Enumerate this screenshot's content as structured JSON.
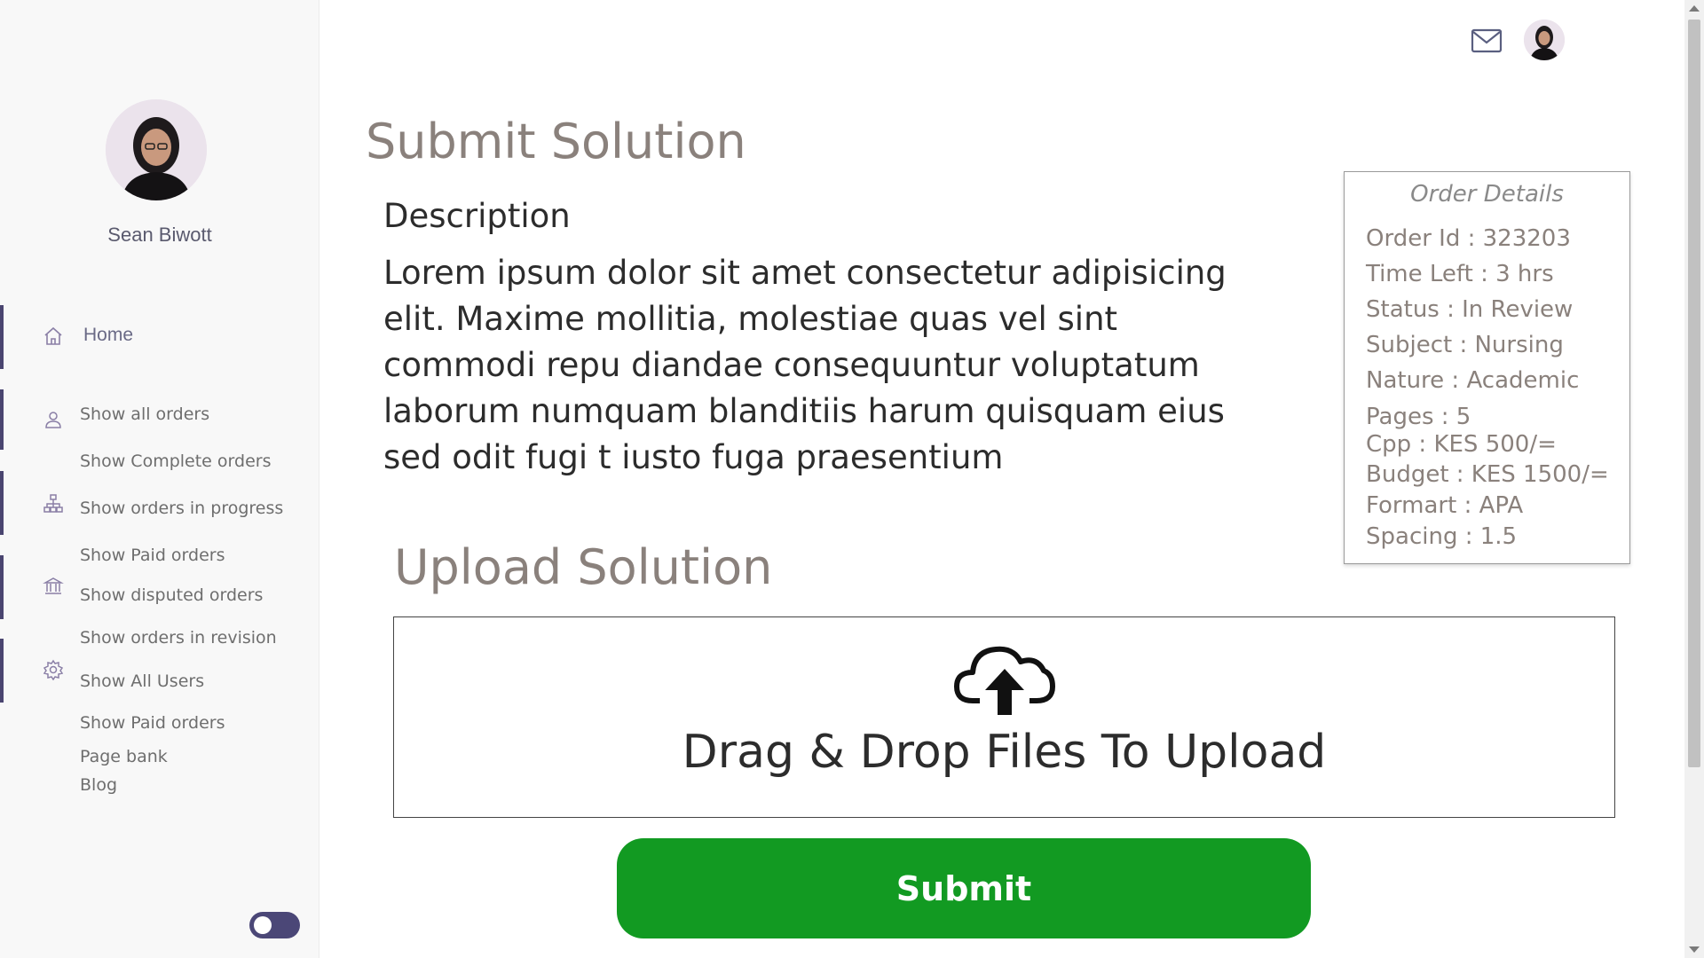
{
  "sidebar": {
    "user_name": "Sean Biwott",
    "home_label": "Home",
    "items": [
      {
        "label": "Show all orders"
      },
      {
        "label": "Show Complete orders"
      },
      {
        "label": "Show orders in progress"
      },
      {
        "label": "Show Paid orders"
      },
      {
        "label": "Show disputed orders"
      },
      {
        "label": "Show orders in revision"
      },
      {
        "label": "Show All Users"
      },
      {
        "label": "Show Paid orders"
      },
      {
        "label": "Page bank"
      },
      {
        "label": "Blog"
      }
    ],
    "icons": [
      "home-icon",
      "user-icon",
      "sitemap-icon",
      "bank-icon",
      "gear-icon"
    ],
    "accent_color": "#4a4570"
  },
  "header": {
    "mail_icon": "mail-icon",
    "avatar": "user-avatar"
  },
  "main": {
    "title": "Submit Solution",
    "description_heading": "Description",
    "description_text": "Lorem ipsum dolor sit amet consectetur adipisicing elit. Maxime mollitia, molestiae quas vel sint commodi repu diandae consequuntur voluptatum laborum numquam blanditiis harum quisquam eius sed odit fugi t iusto fuga praesentium",
    "upload_title": "Upload Solution",
    "dropzone_text": "Drag & Drop Files To Upload",
    "upload_icon": "cloud-upload-icon",
    "submit_label": "Submit",
    "submit_color": "#129a22"
  },
  "order_details": {
    "title": "Order Details",
    "lines": [
      "Order Id : 323203",
      "Time Left : 3 hrs",
      "Status : In Review",
      "Subject : Nursing",
      "Nature : Academic",
      "Pages : 5",
      "Cpp : KES 500/=",
      "Budget : KES 1500/=",
      "Formart : APA",
      "Spacing : 1.5"
    ]
  }
}
